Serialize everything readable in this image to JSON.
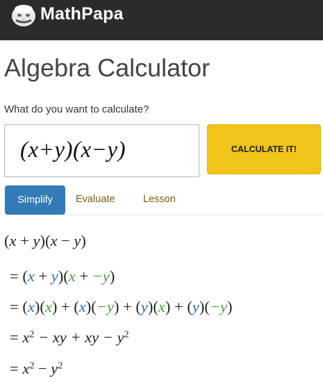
{
  "header": {
    "brand": "MathPapa",
    "logo_icon": "papa-face-icon",
    "bg_color": "#2b2b2b"
  },
  "page": {
    "title": "Algebra Calculator",
    "prompt": "What do you want to calculate?"
  },
  "input": {
    "expression": "(x+y)(x−y)"
  },
  "actions": {
    "calculate_label": "CALCULATE IT!",
    "calculate_color": "#f0c419"
  },
  "tabs": [
    {
      "label": "Simplify",
      "active": true
    },
    {
      "label": "Evaluate",
      "active": false
    },
    {
      "label": "Lesson",
      "active": false
    }
  ],
  "colors": {
    "active_tab": "#337ab7",
    "term_blue": "#2f6fa8",
    "term_green": "#4c9a3c"
  },
  "steps": {
    "s0": {
      "open1": "(",
      "a": "x",
      "plus": " + ",
      "b": "y",
      "mid": ")(",
      "c": "x",
      "minus": " − ",
      "d": "y",
      "close": ")"
    },
    "s1": {
      "eq": "= ",
      "open1": "(",
      "a": "x",
      "plus": " + ",
      "b": "y",
      "mid": ")(",
      "c": "x",
      "plus2": " + ",
      "d": "−y",
      "close": ")"
    },
    "s2": {
      "eq": "= ",
      "t1a": "x",
      "t1b": "x",
      "t2a": "x",
      "t2b": "−y",
      "t3a": "y",
      "t3b": "x",
      "t4a": "y",
      "t4b": "−y",
      "plus": " + "
    },
    "s3": {
      "eq": "= ",
      "x": "x",
      "exp": "2",
      "mid": " − xy + xy − ",
      "y": "y",
      "exp2": "2"
    },
    "s4": {
      "eq": "= ",
      "x": "x",
      "exp": "2",
      "minus": " − ",
      "y": "y",
      "exp2": "2"
    }
  }
}
